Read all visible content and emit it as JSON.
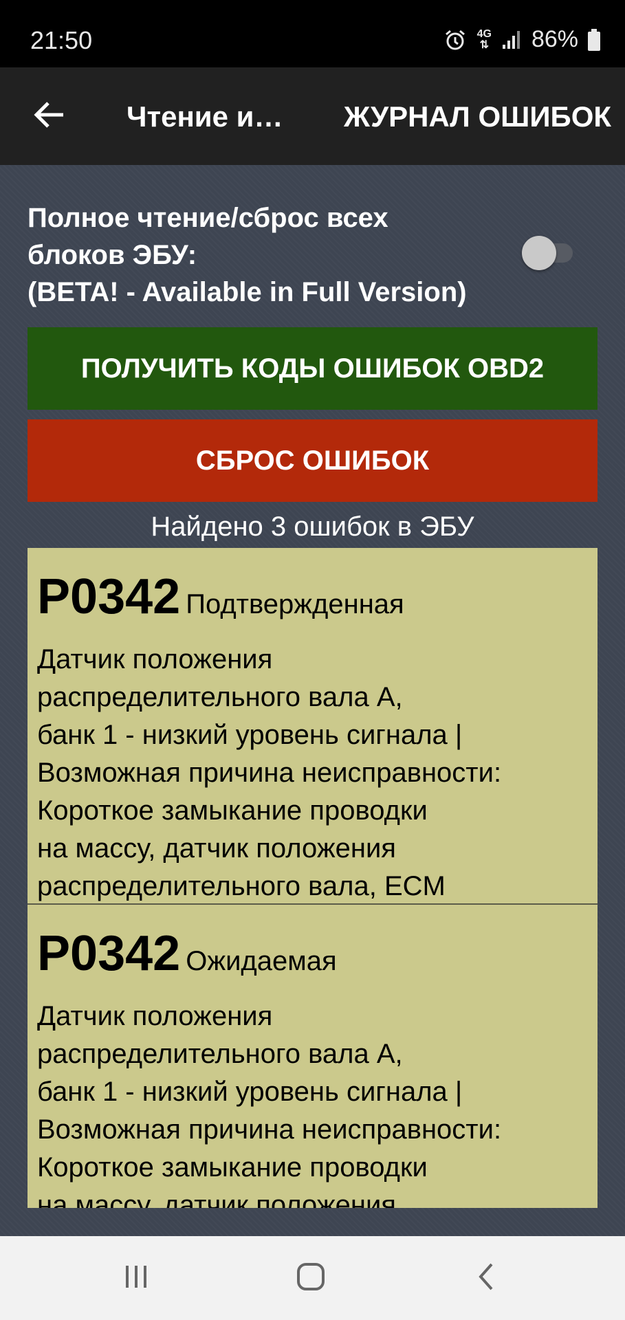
{
  "status_bar": {
    "time": "21:50",
    "network": "4G",
    "battery": "86%"
  },
  "toolbar": {
    "title": "Чтение и…",
    "action": "ЖУРНАЛ ОШИБОК"
  },
  "full_read": {
    "lines": [
      "Полное чтение/сброс всех",
      "блоков ЭБУ:",
      "(BETA! - Available in Full Version)"
    ],
    "enabled": false
  },
  "buttons": {
    "read_codes": "ПОЛУЧИТЬ КОДЫ ОШИБОК OBD2",
    "reset": "СБРОС ОШИБОК"
  },
  "summary": "Найдено 3 ошибок в ЭБУ",
  "errors": [
    {
      "code": "P0342",
      "status": "Подтвержденная",
      "description": [
        "Датчик положения",
        "распределительного вала A,",
        "банк 1 - низкий уровень сигнала |",
        "Возможная причина неисправности:",
        "Короткое замыкание проводки",
        "на массу, датчик положения",
        "распределительного вала, ECM"
      ]
    },
    {
      "code": "P0342",
      "status": "Ожидаемая",
      "description": [
        "Датчик положения",
        "распределительного вала A,",
        "банк 1 - низкий уровень сигнала |",
        "Возможная причина неисправности:",
        "Короткое замыкание проводки",
        "на массу, датчик положения"
      ]
    }
  ],
  "colors": {
    "read_button": "#22580e",
    "reset_button": "#b3290a",
    "error_card": "#cbc98c"
  },
  "icons": {
    "back": "arrow-left-icon",
    "recents": "recents-icon",
    "home": "home-icon",
    "nav_back": "chevron-left-icon"
  }
}
